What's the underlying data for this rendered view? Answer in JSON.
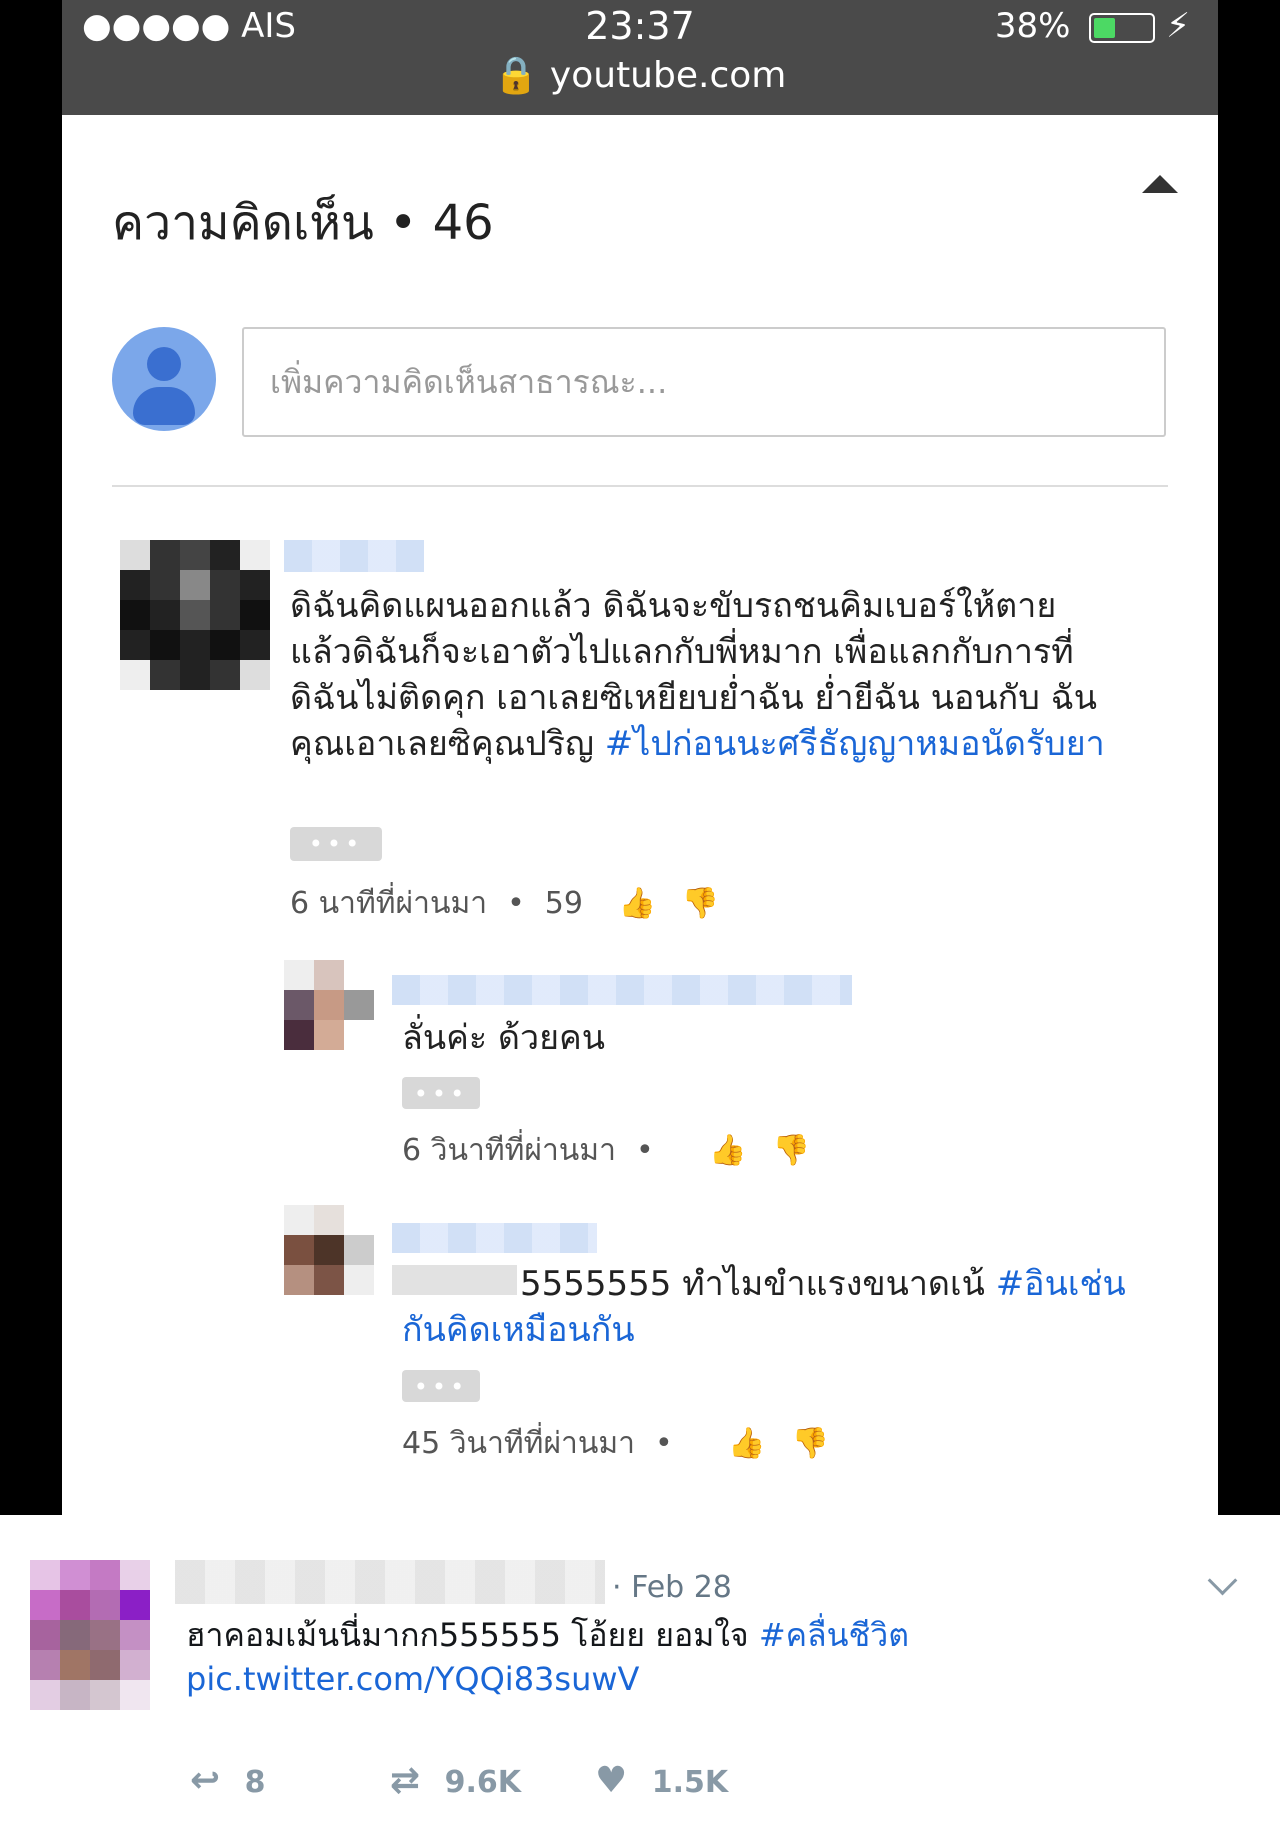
{
  "status": {
    "carrier": "●●●●● AIS",
    "time": "23:37",
    "battery": "38%",
    "url": "youtube.com",
    "battery_level": 0.38
  },
  "comments": {
    "title": "ความคิดเห็น • 46",
    "placeholder": "เพิ่มความคิดเห็นสาธารณะ...",
    "main": {
      "text": "ดิฉันคิดแผนออกแล้ว ดิฉันจะขับรถชนคิมเบอร์ให้ตาย แล้วดิฉันก็จะเอาตัวไปแลกกับพี่หมาก เพื่อแลกกับการที่ ดิฉันไม่ติดคุก เอาเลยซิเหยียบย่ำฉัน ย่ำยีฉัน นอนกับ ฉัน คุณเอาเลยซิคุณปริญ ",
      "hashtag": "#ไปก่อนนะศรีธัญญาหมอนัดรับยา",
      "more": "•••",
      "time": "6 นาทีที่ผ่านมา",
      "likes": "59"
    },
    "reply1": {
      "text": "ลั่นค่ะ ด้วยคน",
      "more": "•••",
      "time": "6 วินาทีที่ผ่านมา"
    },
    "reply2": {
      "text": "5555555 ทำไมขำแรงขนาดเน้ ",
      "hashtag": "#อินเช่นกันคิดเหมือนกัน",
      "more": "•••",
      "time": "45 วินาทีที่ผ่านมา"
    }
  },
  "tweet": {
    "date": "· Feb 28",
    "text": "ฮาคอมเม้นนี่มากก555555 โอ้ยย ยอมใจ ",
    "hashtag": "#คลื่นชีวิต",
    "link": "pic.twitter.com/YQQi83suwV",
    "replies": "8",
    "retweets": "9.6K",
    "likes": "1.5K"
  },
  "colors": {
    "link": "#1a66d6",
    "status_bar": "#4a4a4a",
    "battery": "#4cd964"
  }
}
